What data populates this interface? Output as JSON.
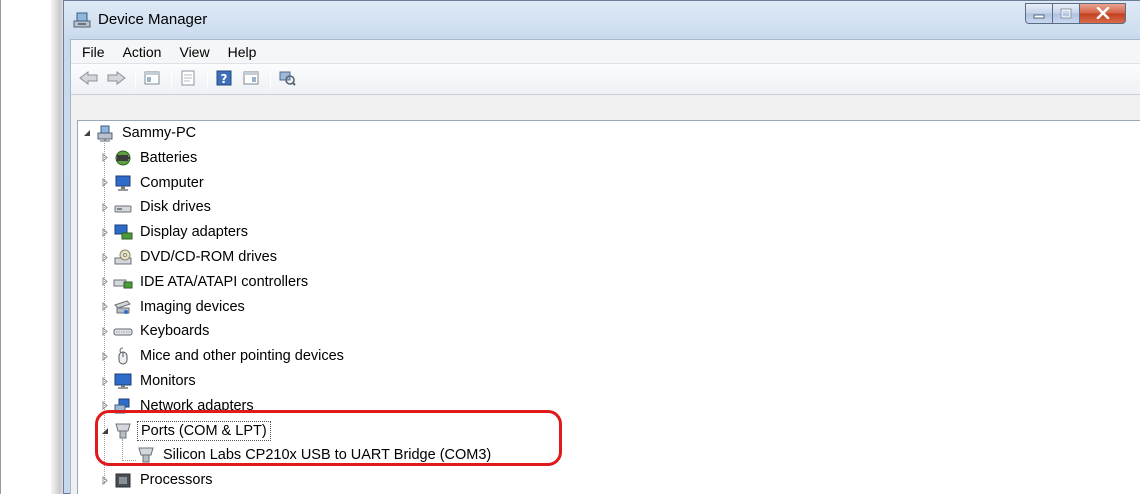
{
  "window": {
    "title": "Device Manager",
    "title_icon": "device-manager-icon",
    "caption_buttons": [
      "minimize-icon",
      "maximize-icon",
      "close-icon"
    ]
  },
  "menu": [
    "File",
    "Action",
    "View",
    "Help"
  ],
  "toolbar": {
    "buttons": [
      "back-arrow-icon",
      "forward-arrow-icon",
      "show-hide-console-tree-icon",
      "properties-icon",
      "help-icon",
      "show-action-pane-icon",
      "scan-hardware-changes-icon"
    ]
  },
  "tree": {
    "root": "Sammy-PC",
    "categories": [
      {
        "label": "Batteries",
        "icon": "battery-icon"
      },
      {
        "label": "Computer",
        "icon": "computer-icon"
      },
      {
        "label": "Disk drives",
        "icon": "disk-drive-icon"
      },
      {
        "label": "Display adapters",
        "icon": "display-adapter-icon"
      },
      {
        "label": "DVD/CD-ROM drives",
        "icon": "dvd-drive-icon"
      },
      {
        "label": "IDE ATA/ATAPI controllers",
        "icon": "ide-controller-icon"
      },
      {
        "label": "Imaging devices",
        "icon": "imaging-device-icon"
      },
      {
        "label": "Keyboards",
        "icon": "keyboard-icon"
      },
      {
        "label": "Mice and other pointing devices",
        "icon": "mouse-icon"
      },
      {
        "label": "Monitors",
        "icon": "monitor-icon"
      },
      {
        "label": "Network adapters",
        "icon": "network-adapter-icon"
      },
      {
        "label": "Ports (COM & LPT)",
        "icon": "port-icon",
        "expanded": true,
        "children": [
          {
            "label": "Silicon Labs CP210x USB to UART Bridge (COM3)",
            "icon": "port-icon"
          }
        ]
      },
      {
        "label": "Processors",
        "icon": "processor-icon"
      }
    ]
  },
  "colors": {
    "highlight_ring": "#e0191b",
    "title_bar": "#cfdff0",
    "close_button": "#c2401f"
  }
}
